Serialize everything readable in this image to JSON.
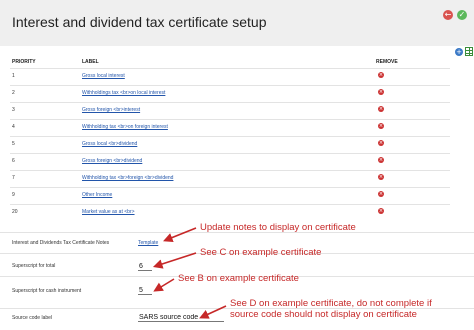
{
  "page": {
    "title": "Interest and dividend tax certificate setup"
  },
  "header_icons": {
    "back": "←",
    "ok": "✓",
    "add": "+"
  },
  "table": {
    "headers": {
      "priority": "PRIORITY",
      "label": "LABEL",
      "remove": "REMOVE"
    },
    "remove_glyph": "×",
    "rows": [
      {
        "priority": "1",
        "label": "Gross local interest"
      },
      {
        "priority": "2",
        "label": "Withholdings tax <br>on local interest"
      },
      {
        "priority": "3",
        "label": "Gross foreign <br>interest"
      },
      {
        "priority": "4",
        "label": "Withholding tax <br>on foreign interest"
      },
      {
        "priority": "5",
        "label": "Gross local <br>dividend"
      },
      {
        "priority": "6",
        "label": "Gross foreign <br>dividend"
      },
      {
        "priority": "7",
        "label": "Withholding tax <br>foreign <br>dividend"
      },
      {
        "priority": "9",
        "label": "Other Income"
      },
      {
        "priority": "20",
        "label": "Market value as at <br>"
      }
    ]
  },
  "form": {
    "notes_label": "Interest and Dividends Tax Certificate Notes",
    "notes_link": "Template",
    "superscript_total_label": "Superscript for total",
    "superscript_total_value": "6",
    "superscript_cash_label": "Superscript for cash instrument",
    "superscript_cash_value": "5",
    "source_code_label": "Source code label",
    "source_code_value": "SARS source code"
  },
  "annotations": {
    "a1": "Update notes to display on certificate",
    "a2": "See C on example certificate",
    "a3": "See B on example certificate",
    "a4_line1": "See D on example certificate, do not complete if",
    "a4_line2": "source code should not display on certificate"
  },
  "colors": {
    "annotation": "#c62828",
    "link": "#2255aa",
    "remove": "#cc3333",
    "header_bg": "#efefef"
  }
}
